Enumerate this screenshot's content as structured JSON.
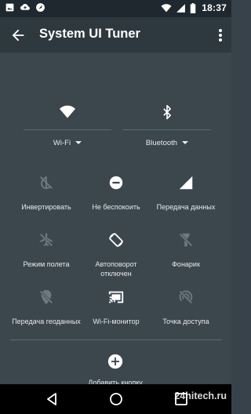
{
  "status_bar": {
    "time": "18:37",
    "icons_left": [
      "image-icon",
      "cloud-upload-icon",
      "navigation-icon"
    ],
    "icons_right": [
      "wifi-icon",
      "signal-icon",
      "battery-icon"
    ]
  },
  "app_bar": {
    "title": "System UI Tuner",
    "back_icon": "arrow-back-icon",
    "menu_icon": "more-vert-icon"
  },
  "big_tiles": [
    {
      "id": "wifi",
      "label": "Wi-Fi",
      "icon": "wifi-icon"
    },
    {
      "id": "bluetooth",
      "label": "Bluetooth",
      "icon": "bluetooth-icon"
    }
  ],
  "tiles": [
    {
      "id": "invert",
      "label": "Инвертировать",
      "icon": "invert-colors-icon",
      "active": false
    },
    {
      "id": "dnd",
      "label": "Не беспокоить",
      "icon": "do-not-disturb-icon",
      "active": true
    },
    {
      "id": "cellular",
      "label": "Передача данных",
      "icon": "cellular-icon",
      "active": true
    },
    {
      "id": "airplane",
      "label": "Режим полета",
      "icon": "airplane-off-icon",
      "active": false
    },
    {
      "id": "rotation",
      "label": "Автоповорот\nотключен",
      "icon": "screen-rotation-icon",
      "active": true
    },
    {
      "id": "flashlight",
      "label": "Фонарик",
      "icon": "flashlight-off-icon",
      "active": false
    },
    {
      "id": "location",
      "label": "Передача геоданных",
      "icon": "location-off-icon",
      "active": false
    },
    {
      "id": "cast",
      "label": "Wi-Fi-монитор",
      "icon": "cast-icon",
      "active": true
    },
    {
      "id": "hotspot",
      "label": "Точка доступа",
      "icon": "hotspot-off-icon",
      "active": false
    }
  ],
  "add_button": {
    "label": "Добавить кнопку",
    "icon": "add-circle-icon"
  },
  "nav_bar": {
    "icons": [
      "nav-back-icon",
      "nav-home-icon",
      "nav-recents-icon"
    ]
  },
  "watermark": "24hitech.ru",
  "colors": {
    "background": "#37424a",
    "panel": "#3b464d",
    "app_bar": "#2e383f",
    "status_bar": "#1f282e",
    "icon_active": "#ffffff",
    "icon_inactive": "#6e7a81",
    "text": "#e7eaec"
  }
}
